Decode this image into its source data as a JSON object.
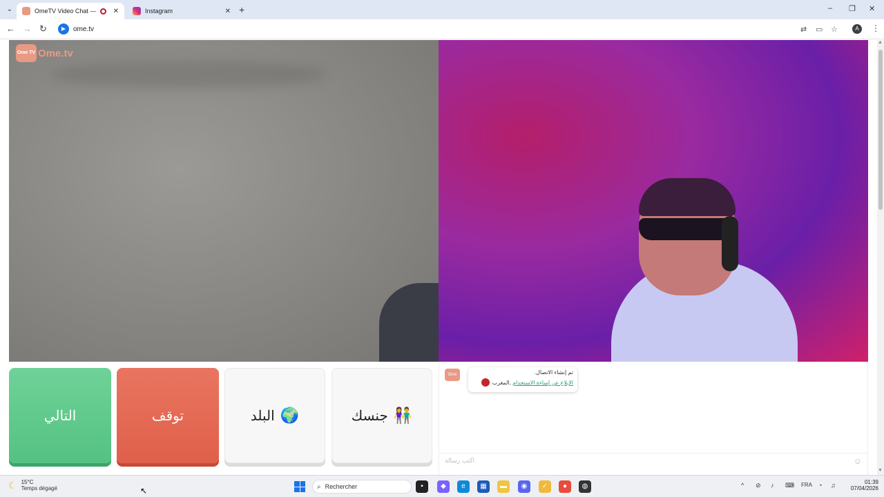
{
  "browser": {
    "tabs": [
      {
        "title": "OmeTV Video Chat — Ome",
        "active": true
      },
      {
        "title": "Instagram",
        "active": false
      }
    ],
    "url": "ome.tv",
    "profile_initial": "A"
  },
  "page": {
    "logo_text": "Ome.tv",
    "logo_badge": "Ome TV",
    "buttons": {
      "next_label": "التالي",
      "stop_label": "توقف",
      "country_label": "البلد",
      "gender_label": "جنسك"
    },
    "chat": {
      "avatar_text": "Ome TV",
      "system_line1": "تم إنشاء الاتصال.",
      "system_country": "المغرب",
      "system_report_link": "الإبلاغ عن إساءة الاستخدام",
      "input_placeholder": "اكتب رسالة"
    }
  },
  "taskbar": {
    "temperature": "15°C",
    "weather": "Temps dégagé",
    "search_placeholder": "Rechercher",
    "language": "FRA",
    "time": "01:39",
    "date": "07/04/2026"
  },
  "colors": {
    "next": "#5cc98a",
    "stop": "#e56a53",
    "accent_link": "#2a9d74",
    "logo": "#e89a84"
  }
}
